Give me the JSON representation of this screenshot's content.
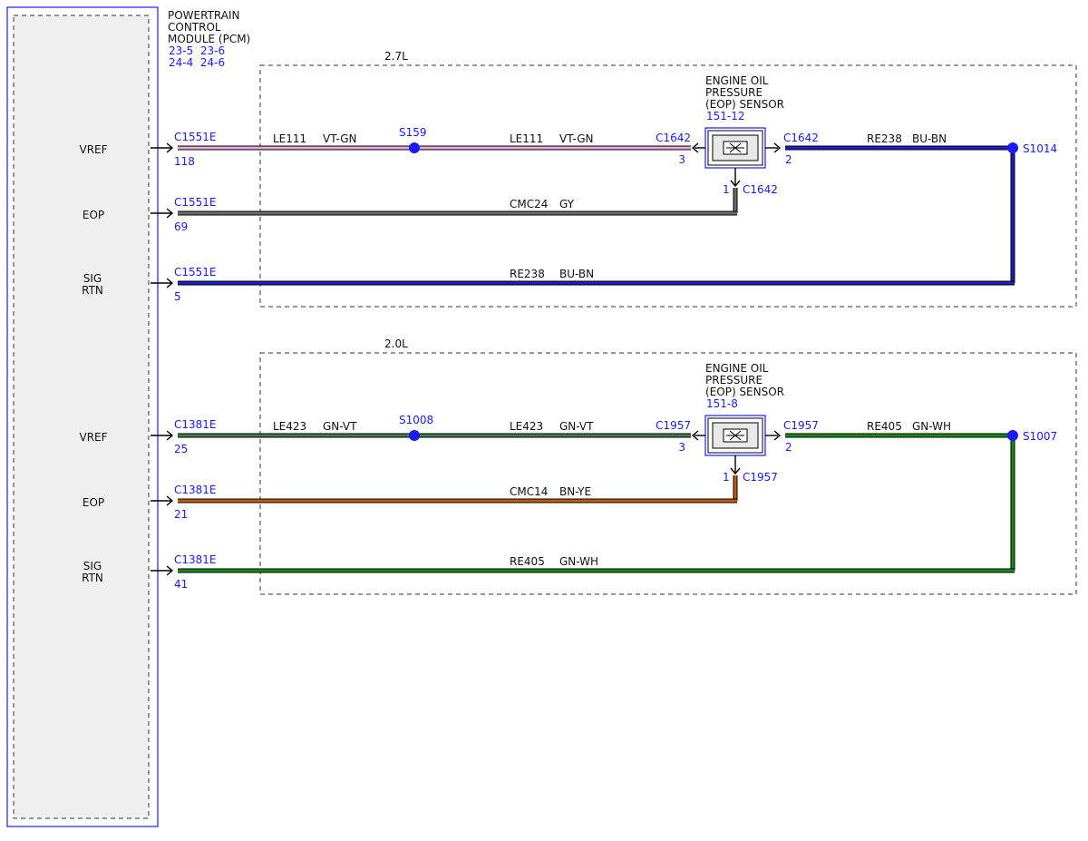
{
  "pcm": {
    "title": [
      "POWERTRAIN",
      "CONTROL",
      "MODULE (PCM)"
    ],
    "refs": [
      "23-5  23-6",
      "24-4  24-6"
    ]
  },
  "colors": {
    "frame_blue": "#1a1aff",
    "VT-GN": "#e8a8d8",
    "GY": "#6e6e6e",
    "BU-BN": "#1c1cc8",
    "GN-VT": "#4a7a50",
    "BN-YE": "#c85a10",
    "GN-WH": "#1a8c1a"
  },
  "sections": [
    {
      "label": "2.7L",
      "sensor": {
        "title": [
          "ENGINE OIL",
          "PRESSURE",
          "(EOP) SENSOR"
        ],
        "ref": "151-12"
      },
      "pins": [
        {
          "name": [
            "VREF"
          ],
          "connector": "C1551E",
          "pin": "118"
        },
        {
          "name": [
            "EOP"
          ],
          "connector": "C1551E",
          "pin": "69"
        },
        {
          "name": [
            "SIG",
            "RTN"
          ],
          "connector": "C1551E",
          "pin": "5"
        }
      ],
      "splice_left": "S159",
      "splice_right": "S1014",
      "wires": {
        "vref_left": {
          "circuit": "LE111",
          "color": "VT-GN"
        },
        "vref_right": {
          "circuit": "LE111",
          "color": "VT-GN"
        },
        "eop": {
          "circuit": "CMC24",
          "color": "GY"
        },
        "rtn_top": {
          "circuit": "RE238",
          "color": "BU-BN"
        },
        "rtn_bottom": {
          "circuit": "RE238",
          "color": "BU-BN"
        }
      },
      "sensor_conn": {
        "left": "C1642",
        "left_pin": "3",
        "right": "C1642",
        "right_pin": "2",
        "bottom": "C1642",
        "bottom_pin": "1"
      }
    },
    {
      "label": "2.0L",
      "sensor": {
        "title": [
          "ENGINE OIL",
          "PRESSURE",
          "(EOP) SENSOR"
        ],
        "ref": "151-8"
      },
      "pins": [
        {
          "name": [
            "VREF"
          ],
          "connector": "C1381E",
          "pin": "25"
        },
        {
          "name": [
            "EOP"
          ],
          "connector": "C1381E",
          "pin": "21"
        },
        {
          "name": [
            "SIG",
            "RTN"
          ],
          "connector": "C1381E",
          "pin": "41"
        }
      ],
      "splice_left": "S1008",
      "splice_right": "S1007",
      "wires": {
        "vref_left": {
          "circuit": "LE423",
          "color": "GN-VT"
        },
        "vref_right": {
          "circuit": "LE423",
          "color": "GN-VT"
        },
        "eop": {
          "circuit": "CMC14",
          "color": "BN-YE"
        },
        "rtn_top": {
          "circuit": "RE405",
          "color": "GN-WH"
        },
        "rtn_bottom": {
          "circuit": "RE405",
          "color": "GN-WH"
        }
      },
      "sensor_conn": {
        "left": "C1957",
        "left_pin": "3",
        "right": "C1957",
        "right_pin": "2",
        "bottom": "C1957",
        "bottom_pin": "1"
      }
    }
  ]
}
